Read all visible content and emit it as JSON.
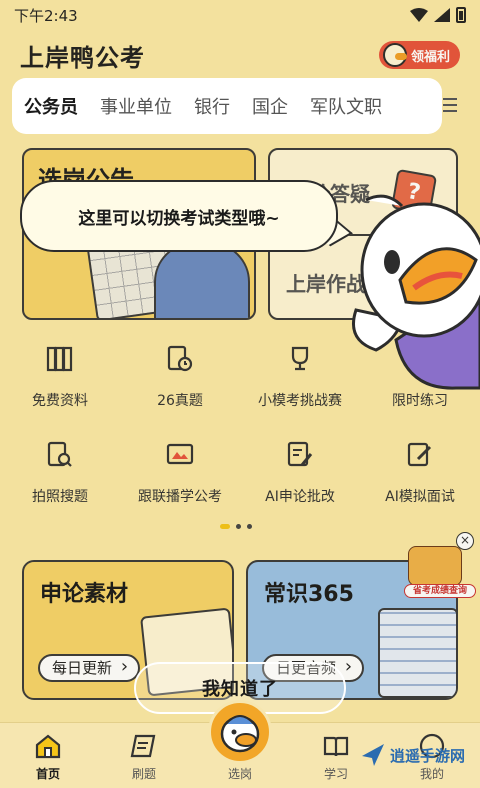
{
  "status_bar": {
    "time": "下午2:43"
  },
  "header": {
    "title": "上岸鸭公考",
    "welfare_label": "领福利"
  },
  "tabs": [
    {
      "label": "公务员",
      "active": true
    },
    {
      "label": "事业单位",
      "active": false
    },
    {
      "label": "银行",
      "active": false
    },
    {
      "label": "国企",
      "active": false
    },
    {
      "label": "军队文职",
      "active": false
    }
  ],
  "top_cards": {
    "left_title": "选岗公告",
    "right_title_1": "申论答疑",
    "right_title_2": "上岸作战"
  },
  "guide": {
    "bubble_text": "这里可以切换考试类型哦~",
    "confirm_label": "我知道了"
  },
  "grid_items": [
    {
      "label": "免费资料",
      "icon": "books-icon"
    },
    {
      "label": "26真题",
      "icon": "exam-clock-icon"
    },
    {
      "label": "小模考挑战赛",
      "icon": "trophy-icon"
    },
    {
      "label": "限时练习",
      "icon": "timer-icon"
    },
    {
      "label": "拍照搜题",
      "icon": "photo-search-icon"
    },
    {
      "label": "跟联播学公考",
      "icon": "tv-icon"
    },
    {
      "label": "AI申论批改",
      "icon": "ai-edit-icon"
    },
    {
      "label": "AI模拟面试",
      "icon": "ai-interview-icon"
    }
  ],
  "promo": {
    "label": "省考成绩查询"
  },
  "bottom_cards": [
    {
      "title": "申论素材",
      "pill": "每日更新"
    },
    {
      "title": "常识365",
      "pill": "日更音频"
    }
  ],
  "bottom_nav": [
    {
      "label": "首页",
      "icon": "home-icon",
      "active": true
    },
    {
      "label": "刷题",
      "icon": "scroll-icon",
      "active": false
    },
    {
      "label": "选岗",
      "icon": "duck-avatar-icon",
      "active": false
    },
    {
      "label": "学习",
      "icon": "book-pen-icon",
      "active": false
    },
    {
      "label": "我的",
      "icon": "profile-icon",
      "active": false
    }
  ],
  "watermark": {
    "text": "逍遥手游网"
  },
  "colors": {
    "brand_yellow": "#f5c518",
    "accent_red": "#e8533c",
    "background": "#fbe9a6"
  }
}
